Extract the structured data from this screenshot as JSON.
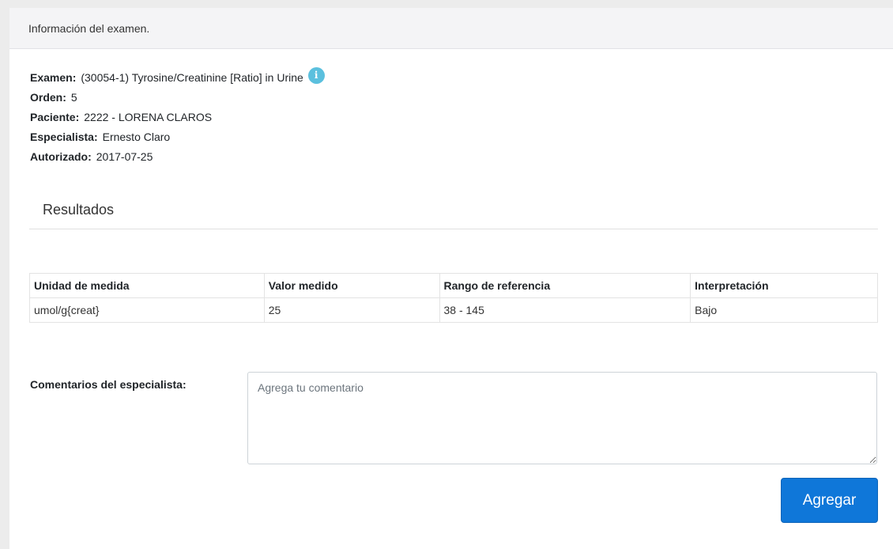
{
  "header": {
    "title": "Información del examen."
  },
  "exam": {
    "examen_label": "Examen:",
    "examen_value": "(30054-1) Tyrosine/Creatinine [Ratio] in Urine",
    "orden_label": "Orden:",
    "orden_value": "5",
    "paciente_label": "Paciente:",
    "paciente_value": "2222 - LORENA CLAROS",
    "especialista_label": "Especialista:",
    "especialista_value": "Ernesto Claro",
    "autorizado_label": "Autorizado:",
    "autorizado_value": "2017-07-25",
    "info_icon": "info-icon",
    "info_icon_color": "#5bc0de"
  },
  "results": {
    "title": "Resultados",
    "columns": [
      "Unidad de medida",
      "Valor medido",
      "Rango de referencia",
      "Interpretación"
    ],
    "rows": [
      [
        "umol/g{creat}",
        "25",
        "38 - 145",
        "Bajo"
      ]
    ]
  },
  "comments": {
    "label": "Comentarios del especialista:",
    "placeholder": "Agrega tu comentario",
    "value": ""
  },
  "actions": {
    "add_label": "Agregar",
    "add_color": "#0f77d9"
  }
}
